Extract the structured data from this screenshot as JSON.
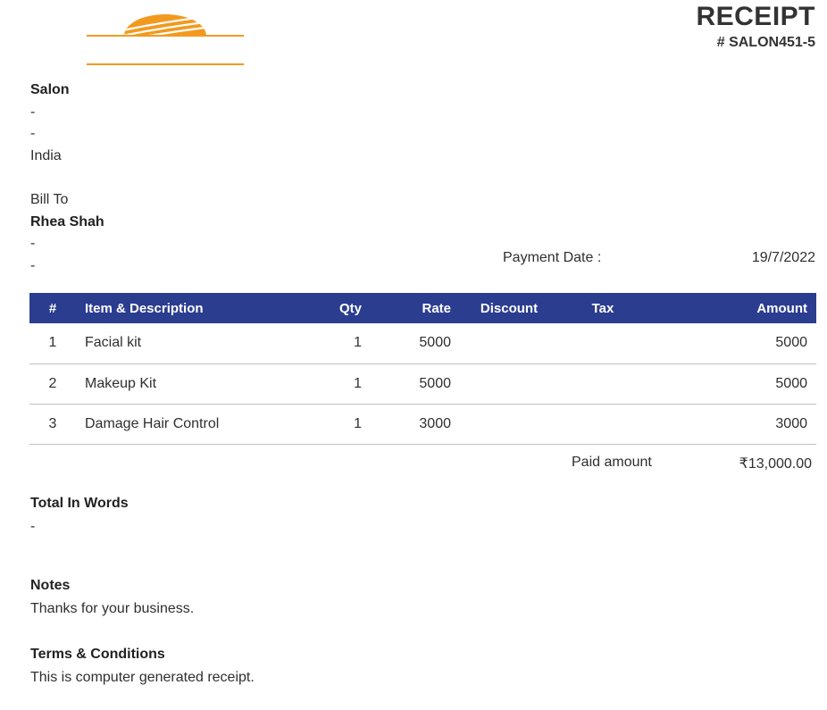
{
  "brand": {
    "logo_color": "#f29a1f"
  },
  "receipt": {
    "title": "RECEIPT",
    "number": "# SALON451-5"
  },
  "from": {
    "name": "Salon",
    "line1": "-",
    "line2": "-",
    "country": "India"
  },
  "bill_to": {
    "label": "Bill To",
    "name": "Rhea Shah",
    "line1": "-",
    "line2": "-"
  },
  "payment": {
    "label": "Payment Date :",
    "date": "19/7/2022"
  },
  "table": {
    "header_color": "#2b3d8f",
    "headers": {
      "num": "#",
      "desc": "Item & Description",
      "qty": "Qty",
      "rate": "Rate",
      "discount": "Discount",
      "tax": "Tax",
      "amount": "Amount"
    },
    "rows": [
      {
        "num": "1",
        "desc": "Facial kit",
        "qty": "1",
        "rate": "5000",
        "discount": "",
        "tax": "",
        "amount": "5000"
      },
      {
        "num": "2",
        "desc": "Makeup Kit",
        "qty": "1",
        "rate": "5000",
        "discount": "",
        "tax": "",
        "amount": "5000"
      },
      {
        "num": "3",
        "desc": "Damage Hair Control",
        "qty": "1",
        "rate": "3000",
        "discount": "",
        "tax": "",
        "amount": "3000"
      }
    ]
  },
  "paid": {
    "label": "Paid amount",
    "value": "₹13,000.00"
  },
  "total_words": {
    "heading": "Total In Words",
    "value": "-"
  },
  "notes": {
    "heading": "Notes",
    "text": "Thanks for your business."
  },
  "terms": {
    "heading": "Terms & Conditions",
    "text": "This is computer generated receipt."
  }
}
